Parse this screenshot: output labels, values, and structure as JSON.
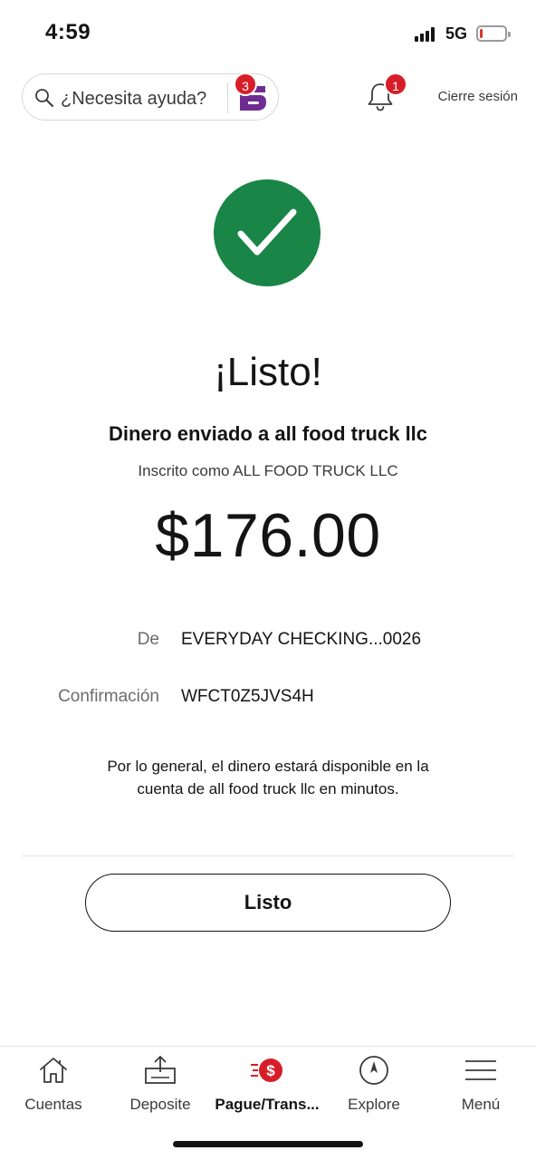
{
  "status_bar": {
    "time": "4:59",
    "network": "5G",
    "battery_level": 0.12,
    "battery_color": "#e0322a"
  },
  "header": {
    "search_placeholder": "¿Necesita ayuda?",
    "assistant_badge": "3",
    "notifications_badge": "1",
    "logout_label": "Cierre sesión"
  },
  "confirmation": {
    "title": "¡Listo!",
    "sent_to": "Dinero enviado a all food truck llc",
    "enrolled_as": "Inscrito como ALL FOOD TRUCK LLC",
    "amount": "$176.00",
    "from_label": "De",
    "from_value": "EVERYDAY CHECKING...0026",
    "confirmation_label": "Confirmación",
    "confirmation_value": "WFCT0Z5JVS4H",
    "note": "Por lo general, el dinero estará disponible en la cuenta de all food truck llc en minutos.",
    "done_button": "Listo",
    "success_color": "#198547"
  },
  "bottom_nav": {
    "items": [
      {
        "label": "Cuentas",
        "icon": "home-icon",
        "active": false
      },
      {
        "label": "Deposite",
        "icon": "deposit-icon",
        "active": false
      },
      {
        "label": "Pague/Trans...",
        "icon": "pay-transfer-icon",
        "active": true
      },
      {
        "label": "Explore",
        "icon": "compass-icon",
        "active": false
      },
      {
        "label": "Menú",
        "icon": "hamburger-menu-icon",
        "active": false
      }
    ],
    "accent_color": "#d71e28"
  }
}
